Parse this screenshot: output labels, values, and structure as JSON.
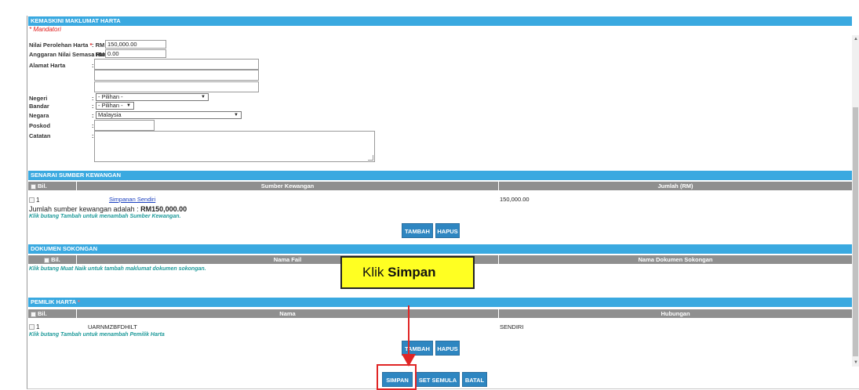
{
  "form": {
    "header": "KEMASKINI MAKLUMAT HARTA",
    "mandatory_note": "* Mandatori",
    "nilai_perolehan_label": "Nilai Perolehan Harta",
    "nilai_perolehan_currency": ": RM",
    "nilai_perolehan_value": "150,000.00",
    "anggaran_label": "Anggaran Nilai Semasa Harta",
    "anggaran_currency": ": RM",
    "anggaran_value": "0.00",
    "alamat_label": "Alamat Harta",
    "negeri_label": "Negeri",
    "negeri_value": "- Pilihan -",
    "bandar_label": "Bandar",
    "bandar_value": "- Pilihan -",
    "negara_label": "Negara",
    "negara_value": "Malaysia",
    "poskod_label": "Poskod",
    "catatan_label": "Catatan",
    "colon": ":"
  },
  "sumber": {
    "header": "SENARAI SUMBER KEWANGAN",
    "col_bil": "Bil.",
    "col_sumber": "Sumber Kewangan",
    "col_jumlah": "Jumlah (RM)",
    "rows": [
      {
        "bil": "1",
        "sumber": "Simpanan Sendiri",
        "jumlah": "150,000.00"
      }
    ],
    "total_text": "Jumlah sumber kewangan adalah :",
    "total_value": "RM150,000.00",
    "hint": "Klik butang Tambah untuk menambah Sumber Kewangan.",
    "tambah": "TAMBAH",
    "hapus": "HAPUS"
  },
  "dokumen": {
    "header": "DOKUMEN SOKONGAN",
    "col_bil": "Bil.",
    "col_nama_fail": "Nama Fail",
    "col_nama_dokumen": "Nama Dokumen Sokongan",
    "hint": "Klik butang Muat Naik untuk tambah maklumat dokumen sokongan."
  },
  "pemilik": {
    "header": "PEMILIK HARTA",
    "col_bil": "Bil.",
    "col_nama": "Nama",
    "col_hubungan": "Hubungan",
    "rows": [
      {
        "bil": "1",
        "nama": "UARNMZBFDHILT",
        "hubungan": "SENDIRI"
      }
    ],
    "hint": "Klik butang Tambah untuk menambah Pemilik Harta",
    "tambah": "TAMBAH",
    "hapus": "HAPUS"
  },
  "actions": {
    "simpan": "SIMPAN",
    "set_semula": "SET SEMULA",
    "batal": "BATAL"
  },
  "annotation": {
    "callout_prefix": "Klik",
    "callout_bold": "Simpan",
    "arrow_color": "#e02525",
    "highlight_color": "#e02525"
  },
  "icons": {
    "select_arrow": "dropdown-arrow-icon",
    "checkbox": "checkbox-icon"
  }
}
